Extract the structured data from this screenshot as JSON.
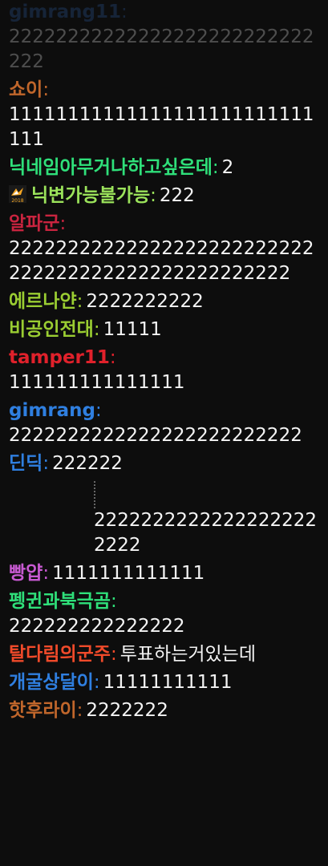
{
  "messages": [
    {
      "nick": "gimrang11",
      "color": "#2f5fa8",
      "text": "22222222222222222222222222222",
      "faded": true
    },
    {
      "nick": "쇼이",
      "color": "#c0662b",
      "text": "11111111111111111111111111111"
    },
    {
      "nick": "닉네임아무거나하고싶은데",
      "color": "#2fe07a",
      "text": "2"
    },
    {
      "nick": "닉변가능불가능",
      "color": "#9be35b",
      "text": "222",
      "badge": "2018"
    },
    {
      "nick": "알파군",
      "color": "#c9243f",
      "text": "22222222222222222222222222222222222222222222222222"
    },
    {
      "nick": "에르나얀",
      "color": "#9acd32",
      "text": "2222222222"
    },
    {
      "nick": "비공인전대",
      "color": "#9acd32",
      "text": "11111"
    },
    {
      "nick": "tamper11",
      "color": "#e0212b",
      "text": "111111111111111"
    },
    {
      "nick": "gimrang",
      "color": "#2f7fe0",
      "text": "2222222222222222222222222"
    },
    {
      "nick": "딘딕",
      "color": "#2f7fe0",
      "text": "222222"
    },
    {
      "nick": "",
      "color": "#888888",
      "text": "22222222222222222222222"
    },
    {
      "nick": "빵얍",
      "color": "#c85ad2",
      "text": "1111111111111"
    },
    {
      "nick": "펭귄과북극곰",
      "color": "#2fe07a",
      "text": "222222222222222"
    },
    {
      "nick": "탈다림의군주",
      "color": "#f04a2a",
      "text": "투표하는거있는데"
    },
    {
      "nick": "개굴상달이",
      "color": "#2f7fe0",
      "text": "11111111111"
    },
    {
      "nick": "핫후라이",
      "color": "#c0662b",
      "text": "2222222"
    }
  ],
  "badge": {
    "label": "2018",
    "colors": {
      "bg": "#1a1a1a",
      "bird": "#f5a623",
      "text": "#f5a623"
    }
  }
}
